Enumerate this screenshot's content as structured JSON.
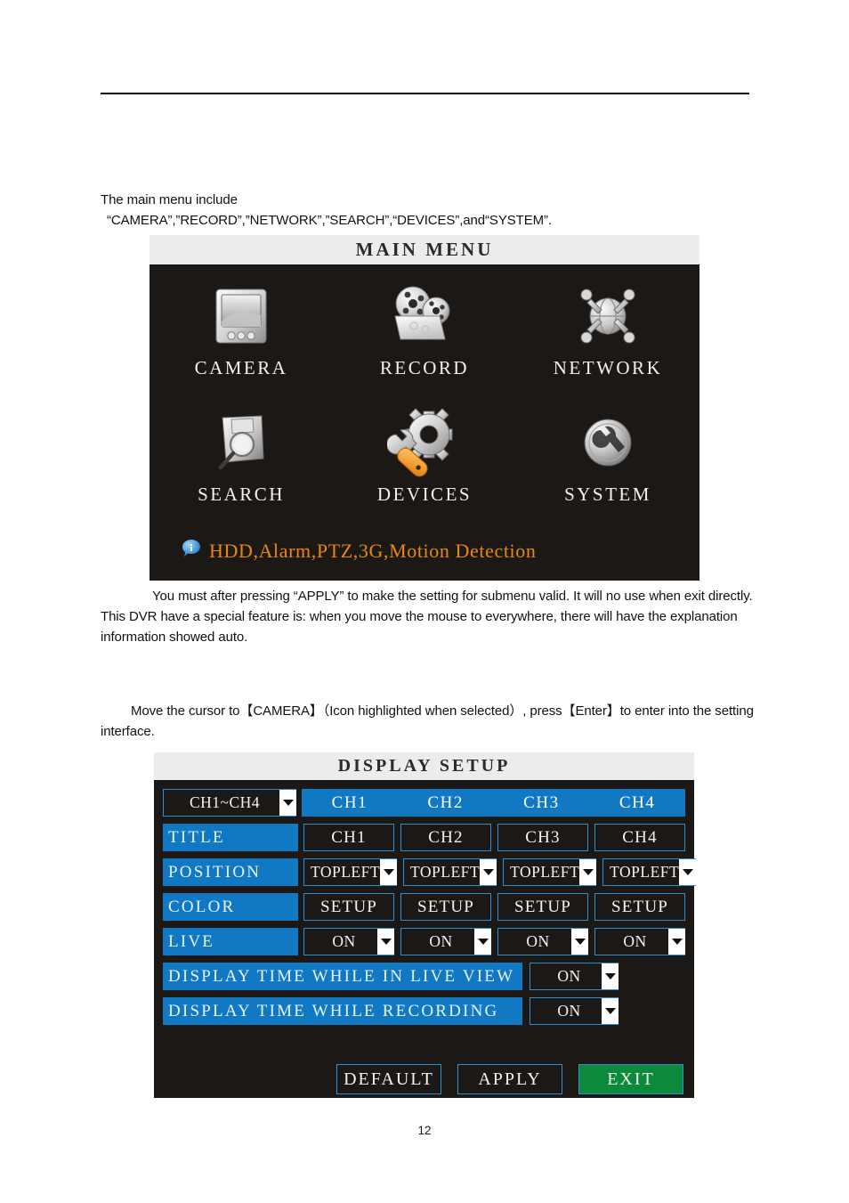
{
  "page": {
    "number": "12"
  },
  "intro": {
    "line1": "The main menu include",
    "line2": "“CAMERA”,”RECORD”,”NETWORK”,”SEARCH”,“DEVICES”,and“SYSTEM”."
  },
  "apply_note": {
    "text": "You must after pressing “APPLY” to make the setting for submenu valid. It will no use when exit directly. This DVR have a special feature is: when you move the mouse to everywhere, there will have the explanation information showed auto."
  },
  "move_note": {
    "text": "Move the cursor to【CAMERA】（Icon highlighted when selected）, press【Enter】to enter into the setting interface."
  },
  "main_menu": {
    "title": "MAIN MENU",
    "items": [
      {
        "label": "CAMERA",
        "icon": "monitor-icon"
      },
      {
        "label": "RECORD",
        "icon": "film-reel-icon"
      },
      {
        "label": "NETWORK",
        "icon": "globe-network-icon"
      },
      {
        "label": "SEARCH",
        "icon": "magnifier-disk-icon"
      },
      {
        "label": "DEVICES",
        "icon": "gear-wrench-icon"
      },
      {
        "label": "SYSTEM",
        "icon": "wrench-circle-icon"
      }
    ],
    "hint": "HDD,Alarm,PTZ,3G,Motion Detection",
    "hint_icon": "info-bubble-icon",
    "hint_color": "#e8890f",
    "background_color": "#1c1816",
    "titlebar_color": "#ececec"
  },
  "display_setup": {
    "title": "DISPLAY SETUP",
    "channel_selector": {
      "value": "CH1~CH4",
      "icon": "chevron-down-icon"
    },
    "channel_headers": [
      "CH1",
      "CH2",
      "CH3",
      "CH4"
    ],
    "rows": [
      {
        "label": "TITLE",
        "type": "text",
        "values": [
          "CH1",
          "CH2",
          "CH3",
          "CH4"
        ]
      },
      {
        "label": "POSITION",
        "type": "select",
        "values": [
          "TOPLEFT",
          "TOPLEFT",
          "TOPLEFT",
          "TOPLEFT"
        ]
      },
      {
        "label": "COLOR",
        "type": "button",
        "values": [
          "SETUP",
          "SETUP",
          "SETUP",
          "SETUP"
        ]
      },
      {
        "label": "LIVE",
        "type": "select",
        "values": [
          "ON",
          "ON",
          "ON",
          "ON"
        ]
      }
    ],
    "wide_rows": [
      {
        "label": "DISPLAY TIME WHILE IN LIVE VIEW",
        "value": "ON"
      },
      {
        "label": "DISPLAY TIME WHILE RECORDING",
        "value": "ON"
      }
    ],
    "buttons": [
      {
        "label": "DEFAULT",
        "style": "normal"
      },
      {
        "label": "APPLY",
        "style": "normal"
      },
      {
        "label": "EXIT",
        "style": "primary"
      }
    ],
    "accent_color": "#1178c3",
    "exit_color": "#0b8a3c",
    "background_color": "#1c1816"
  }
}
